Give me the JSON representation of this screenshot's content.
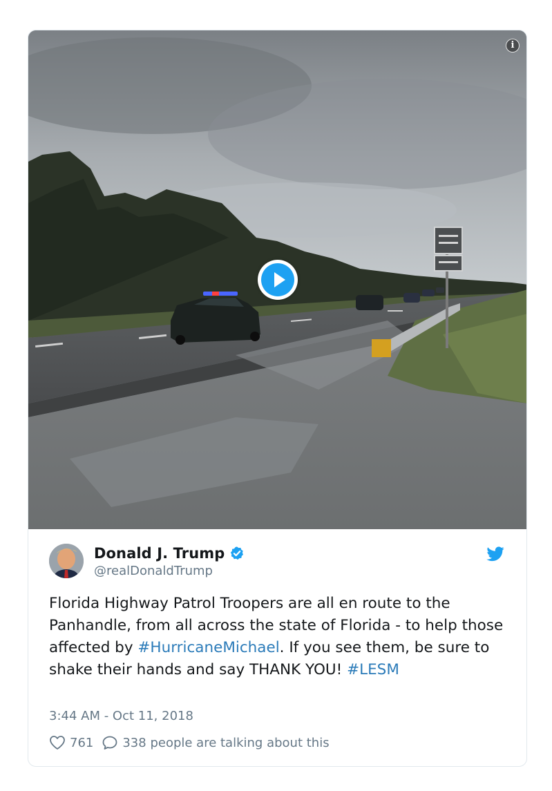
{
  "media": {
    "info_icon": "info-icon",
    "info_glyph": "i",
    "play_icon": "play-icon"
  },
  "author": {
    "display_name": "Donald J. Trump",
    "handle": "@realDonaldTrump",
    "verified_icon": "verified-badge-icon",
    "avatar": "avatar"
  },
  "platform_icon": "twitter-bird-icon",
  "tweet": {
    "text_1": "Florida Highway Patrol Troopers are all en route to the Panhandle, from all across the state of Florida - to help those affected by ",
    "hashtag_1": "#HurricaneMichael",
    "text_2": ". If you see them, be sure to shake their hands and say THANK YOU! ",
    "hashtag_2": "#LESM"
  },
  "timestamp": "3:44 AM - Oct 11, 2018",
  "actions": {
    "likes": "761",
    "like_icon": "heart-icon",
    "reply_icon": "speech-bubble-icon",
    "talking": "338 people are talking about this"
  },
  "colors": {
    "accent": "#1da1f2",
    "link": "#2b7bb9",
    "secondary_text": "#657786",
    "border": "#e1e8ed"
  }
}
